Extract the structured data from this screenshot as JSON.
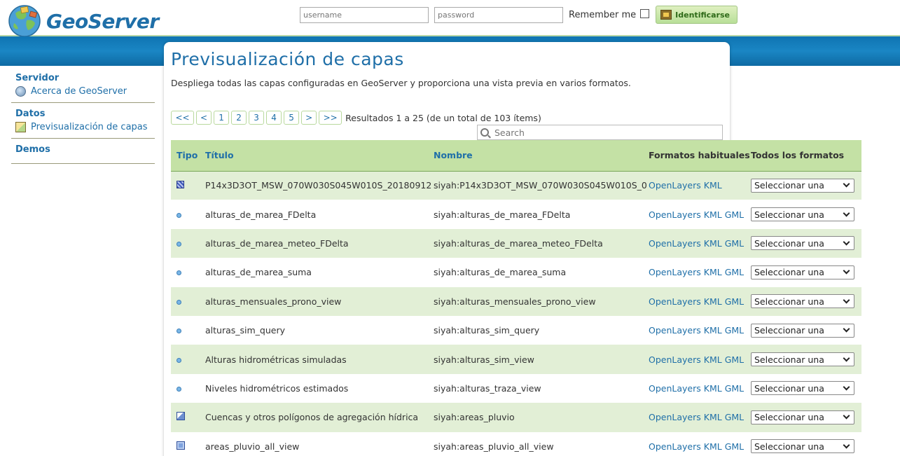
{
  "header": {
    "logo_text": "GeoServer",
    "username_placeholder": "username",
    "password_placeholder": "password",
    "remember_label": "Remember me",
    "login_button": "Identificarse"
  },
  "sidebar": {
    "sections": [
      {
        "heading": "Servidor",
        "items": [
          {
            "label": "Acerca de GeoServer",
            "icon": "about-icon"
          }
        ]
      },
      {
        "heading": "Datos",
        "items": [
          {
            "label": "Previsualización de capas",
            "icon": "layer-preview-icon"
          }
        ]
      },
      {
        "heading": "Demos",
        "items": []
      }
    ]
  },
  "page": {
    "title": "Previsualización de capas",
    "description": "Despliega todas las capas configuradas en GeoServer y proporciona una vista previa en varios formatos."
  },
  "pager": {
    "first": "<<",
    "prev": "<",
    "pages": [
      "1",
      "2",
      "3",
      "4",
      "5"
    ],
    "next": ">",
    "last": ">>",
    "results": "Resultados 1 a 25 (de un total de 103 ítems)"
  },
  "search": {
    "placeholder": "Search"
  },
  "table": {
    "headers": {
      "type": "Tipo",
      "title": "Título",
      "name": "Nombre",
      "formats": "Formatos habituales",
      "all_formats": "Todos los formatos"
    },
    "rows": [
      {
        "type": "raster",
        "title": "P14x3D3OT_MSW_070W030S045W010S_20180912",
        "name": "siyah:P14x3D3OT_MSW_070W030S045W010S_0",
        "formats": [
          "OpenLayers",
          "KML"
        ],
        "select": "Seleccionar una"
      },
      {
        "type": "point",
        "title": "alturas_de_marea_FDelta",
        "name": "siyah:alturas_de_marea_FDelta",
        "formats": [
          "OpenLayers",
          "KML",
          "GML"
        ],
        "select": "Seleccionar una"
      },
      {
        "type": "point",
        "title": "alturas_de_marea_meteo_FDelta",
        "name": "siyah:alturas_de_marea_meteo_FDelta",
        "formats": [
          "OpenLayers",
          "KML",
          "GML"
        ],
        "select": "Seleccionar una"
      },
      {
        "type": "point",
        "title": "alturas_de_marea_suma",
        "name": "siyah:alturas_de_marea_suma",
        "formats": [
          "OpenLayers",
          "KML",
          "GML"
        ],
        "select": "Seleccionar una"
      },
      {
        "type": "point",
        "title": "alturas_mensuales_prono_view",
        "name": "siyah:alturas_mensuales_prono_view",
        "formats": [
          "OpenLayers",
          "KML",
          "GML"
        ],
        "select": "Seleccionar una"
      },
      {
        "type": "point",
        "title": "alturas_sim_query",
        "name": "siyah:alturas_sim_query",
        "formats": [
          "OpenLayers",
          "KML",
          "GML"
        ],
        "select": "Seleccionar una"
      },
      {
        "type": "point",
        "title": "Alturas hidrométricas simuladas",
        "name": "siyah:alturas_sim_view",
        "formats": [
          "OpenLayers",
          "KML",
          "GML"
        ],
        "select": "Seleccionar una"
      },
      {
        "type": "point",
        "title": "Niveles hidrométricos estimados",
        "name": "siyah:alturas_traza_view",
        "formats": [
          "OpenLayers",
          "KML",
          "GML"
        ],
        "select": "Seleccionar una"
      },
      {
        "type": "polygon",
        "title": "Cuencas y otros polígonos de agregación hídrica",
        "name": "siyah:areas_pluvio",
        "formats": [
          "OpenLayers",
          "KML",
          "GML"
        ],
        "select": "Seleccionar una"
      },
      {
        "type": "group",
        "title": "areas_pluvio_all_view",
        "name": "siyah:areas_pluvio_all_view",
        "formats": [
          "OpenLayers",
          "KML",
          "GML"
        ],
        "select": "Seleccionar una"
      }
    ]
  },
  "colors": {
    "brand_blue": "#1f6fa8",
    "header_green": "#c4e1a5",
    "row_stripe": "#e2efd6",
    "band_blue": "#1a86c4"
  }
}
